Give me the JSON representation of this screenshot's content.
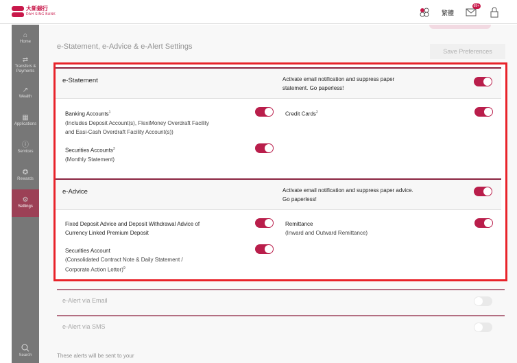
{
  "brand": {
    "name_cn": "大新銀行",
    "name_en": "DAH SING BANK"
  },
  "topbar": {
    "lang_label": "繁體",
    "mail_badge": "99+"
  },
  "sidebar": {
    "items": [
      {
        "label": "Home",
        "icon": "home-icon",
        "glyph": "⌂"
      },
      {
        "label": "Transfers & Payments",
        "icon": "transfer-icon",
        "glyph": "⇄"
      },
      {
        "label": "Wealth",
        "icon": "chart-icon",
        "glyph": "↗"
      },
      {
        "label": "Applications",
        "icon": "apps-icon",
        "glyph": "▦"
      },
      {
        "label": "Services",
        "icon": "info-icon",
        "glyph": "ⓘ"
      },
      {
        "label": "Rewards",
        "icon": "rewards-icon",
        "glyph": "✪"
      },
      {
        "label": "Settings",
        "icon": "gear-icon",
        "glyph": "⚙"
      }
    ],
    "search_label": "Search"
  },
  "page": {
    "title": "e-Statement, e-Advice & e-Alert Settings",
    "save_label": "Save Preferences"
  },
  "estatement": {
    "title": "e-Statement",
    "note": "Activate email notification and suppress paper statement. Go paperless!",
    "banking_label": "Banking Accounts",
    "banking_sup": "1",
    "banking_desc": "(Includes Deposit Account(s), FlexiMoney Overdraft Facility and Easi-Cash Overdraft Facility Account(s))",
    "credit_label": "Credit Cards",
    "credit_sup": "2",
    "securities_label": "Securities Accounts",
    "securities_sup": "3",
    "securities_desc": "(Monthly Statement)"
  },
  "eadvice": {
    "title": "e-Advice",
    "note": "Activate email notification and suppress paper advice. Go paperless!",
    "fixed_label": "Fixed Deposit Advice and Deposit Withdrawal Advice of Currency Linked Premium Deposit",
    "remittance_label": "Remittance",
    "remittance_desc": "(Inward and Outward Remittance)",
    "securities_label": "Securities Account",
    "securities_desc": "(Consolidated Contract Note & Daily Statement / Corporate Action Letter)",
    "securities_sup": "9"
  },
  "ealert": {
    "email_label": "e-Alert via Email",
    "sms_label": "e-Alert via SMS",
    "footer": "These alerts will be sent to your"
  },
  "colors": {
    "accent": "#b91e4b",
    "highlight": "#e8232a"
  }
}
